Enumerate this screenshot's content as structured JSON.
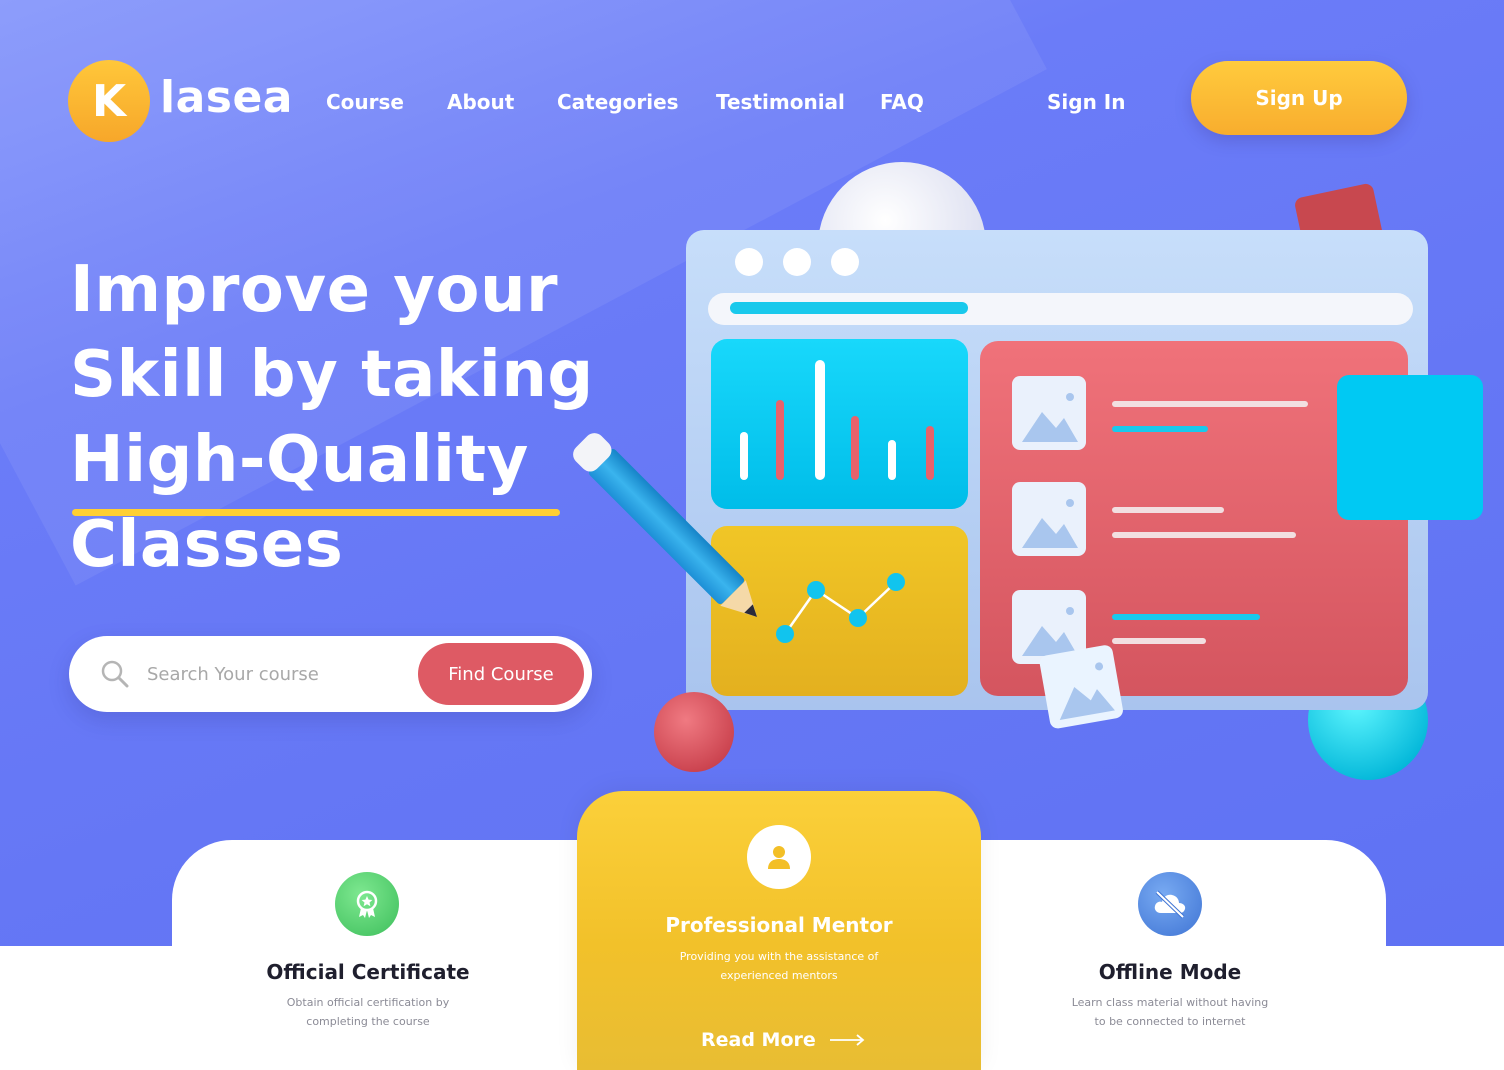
{
  "brand": {
    "logo_letter": "K",
    "name": "lasea"
  },
  "nav": {
    "links": [
      "Course",
      "About",
      "Categories",
      "Testimonial",
      "FAQ"
    ],
    "sign_in": "Sign In",
    "sign_up": "Sign Up"
  },
  "hero": {
    "headline_lines": [
      "Improve your",
      "Skill by taking",
      "High-Quality",
      "Classes"
    ],
    "search_placeholder": "Search Your course",
    "search_button": "Find Course"
  },
  "features": [
    {
      "title": "Official Certificate",
      "desc_lines": [
        "Obtain official certification by",
        "completing the course"
      ],
      "icon": "certificate-icon",
      "color": "#4fd06d"
    },
    {
      "title": "Professional Mentor",
      "desc_lines": [
        "Providing you with the assistance of",
        "experienced mentors"
      ],
      "icon": "user-icon",
      "action": "Read More"
    },
    {
      "title": "Offline Mode",
      "desc_lines": [
        "Learn class material without having",
        "to be connected to internet"
      ],
      "icon": "offline-cloud-icon",
      "color": "#4f86e0"
    }
  ],
  "colors": {
    "hero_bg": "#6577f5",
    "accent_yellow": "#fbc73a",
    "accent_red": "#de5a64",
    "accent_cyan": "#00c8f0",
    "certificate_green": "#4fd06d",
    "offline_blue": "#4f86e0"
  }
}
